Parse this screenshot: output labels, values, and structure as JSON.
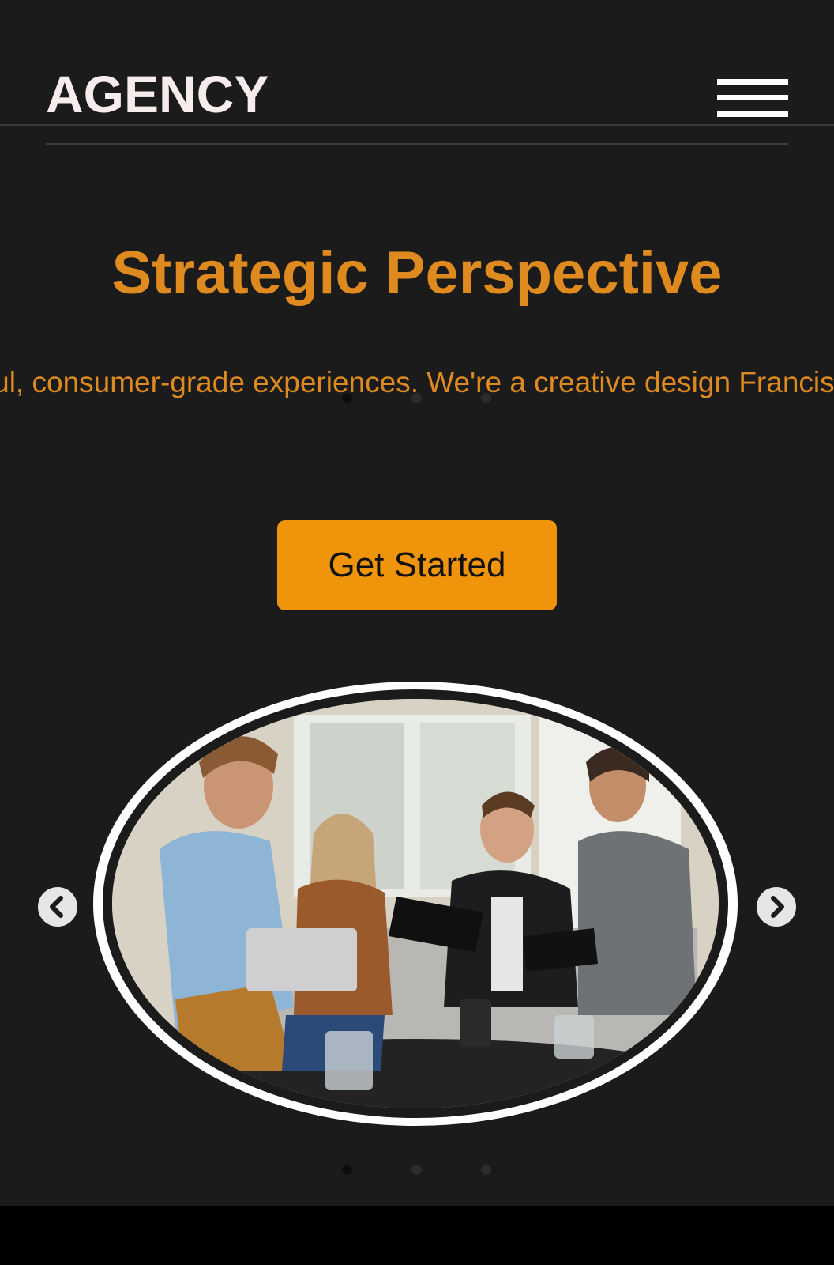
{
  "header": {
    "brand": "AGENCY",
    "menu_icon": "hamburger-menu-icon"
  },
  "hero": {
    "title": "Strategic Perspective",
    "text": "ntful, consumer-grade experiences. We're a creative design Francisco.",
    "cta_label": "Get Started"
  },
  "carousel": {
    "prev_icon": "chevron-left-icon",
    "next_icon": "chevron-right-icon",
    "slide_count": 3,
    "active_index": 0
  },
  "colors": {
    "background": "#1b1b1b",
    "accent_text": "#de8a1f",
    "button": "#f0950b",
    "brand_text": "#f6ecec"
  }
}
